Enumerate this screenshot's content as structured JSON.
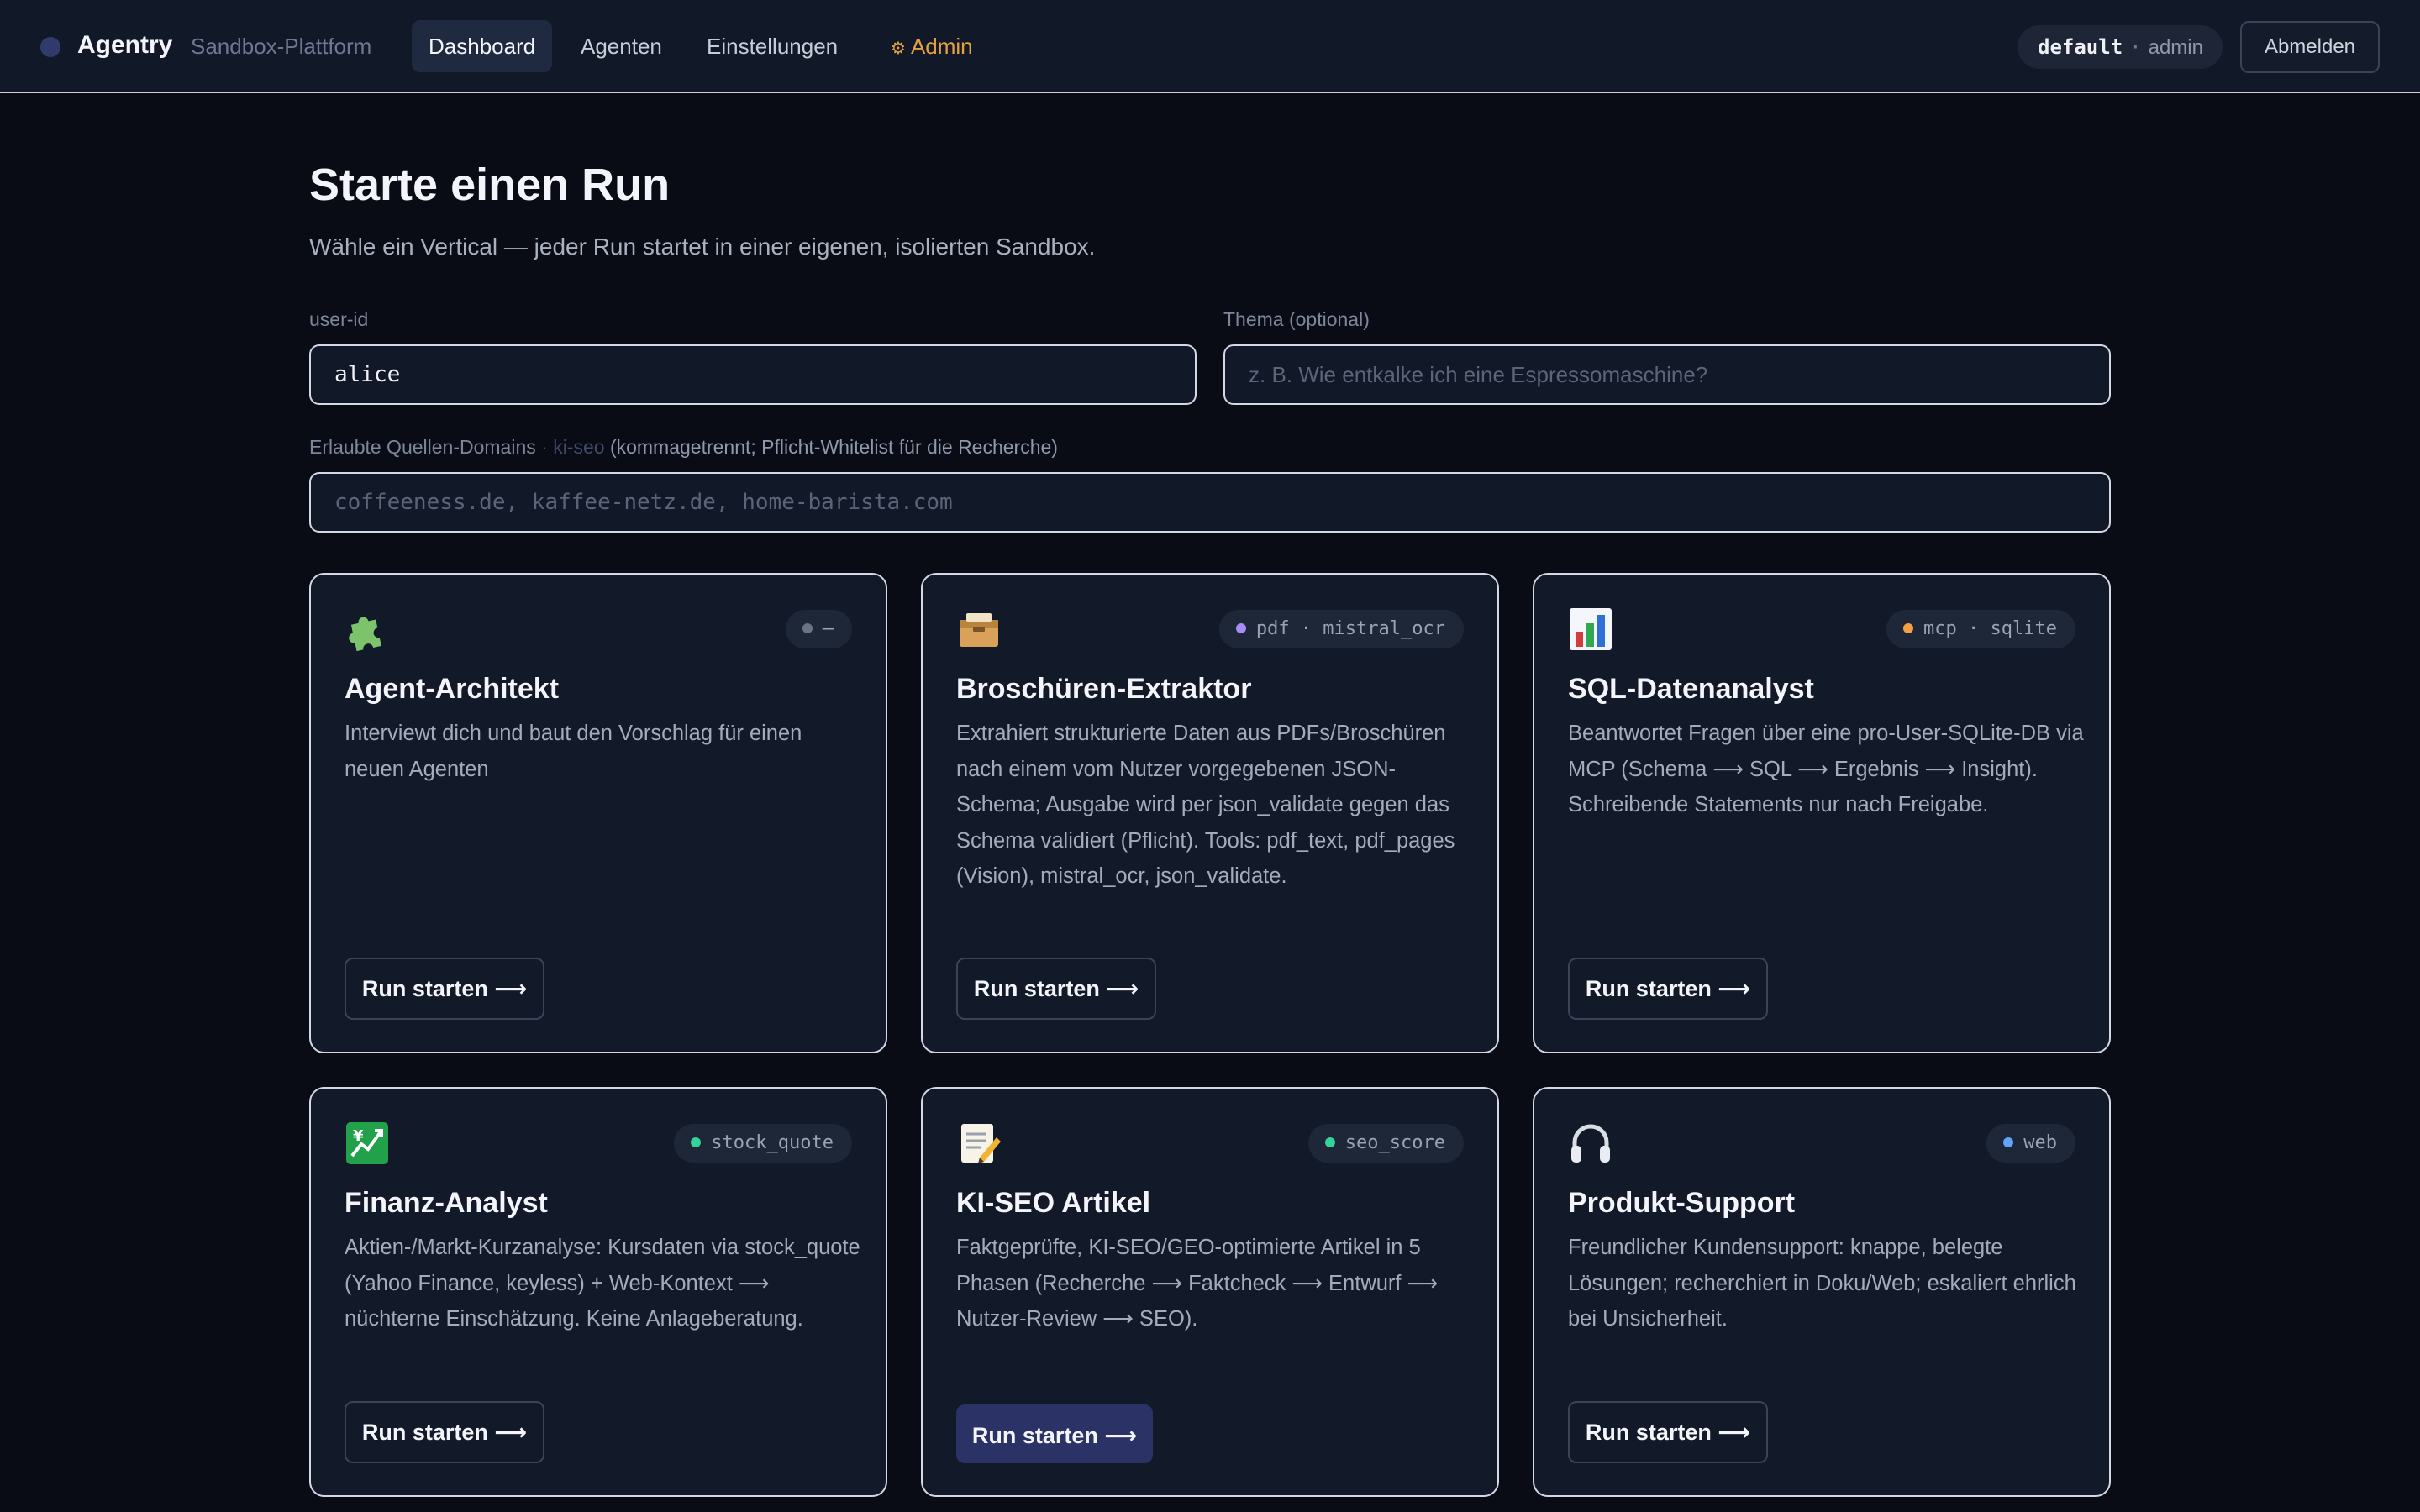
{
  "app": {
    "name": "Agentry",
    "subtitle": "Sandbox-Plattform"
  },
  "nav": {
    "items": [
      {
        "label": "Dashboard",
        "active": true
      },
      {
        "label": "Agenten",
        "active": false
      },
      {
        "label": "Einstellungen",
        "active": false
      },
      {
        "label": "Admin",
        "active": false,
        "icon": "gear-icon"
      }
    ],
    "admin_icon": "⚙"
  },
  "account": {
    "tenant": "default",
    "separator": "·",
    "role": "admin",
    "logout_label": "Abmelden"
  },
  "page": {
    "title": "Starte einen Run",
    "subtitle": "Wähle ein Vertical — jeder Run startet in einer eigenen, isolierten Sandbox."
  },
  "form": {
    "user_id": {
      "label": "user-id",
      "value": "alice"
    },
    "topic": {
      "label": "Thema (optional)",
      "placeholder": "z. B. Wie entkalke ich eine Espressomaschine?"
    },
    "domains": {
      "label": "Erlaubte Quellen-Domains",
      "tag": "· ki-seo",
      "hint": "(kommagetrennt; Pflicht-Whitelist für die Recherche)",
      "placeholder": "coffeeness.de, kaffee-netz.de, home-barista.com"
    }
  },
  "cards": [
    {
      "icon": "puzzle-icon",
      "badge": "–",
      "badge_color": "#6b7386",
      "title": "Agent-Architekt",
      "description": "Interviewt dich und baut den Vorschlag für einen neuen Agenten",
      "button": "Run starten ⟶"
    },
    {
      "icon": "card-box-icon",
      "badge": "pdf · mistral_ocr",
      "badge_color": "#a78bfa",
      "title": "Broschüren-Extraktor",
      "description": "Extrahiert strukturierte Daten aus PDFs/Broschüren nach einem vom Nutzer vorgegebenen JSON-Schema; Ausgabe wird per json_validate gegen das Schema validiert (Pflicht). Tools: pdf_text, pdf_pages (Vision), mistral_ocr, json_validate.",
      "button": "Run starten ⟶"
    },
    {
      "icon": "bar-chart-icon",
      "badge": "mcp · sqlite",
      "badge_color": "#f59e42",
      "title": "SQL-Datenanalyst",
      "description": "Beantwortet Fragen über eine pro-User-SQLite-DB via MCP (Schema ⟶ SQL ⟶ Ergebnis ⟶ Insight). Schreibende Statements nur nach Freigabe.",
      "button": "Run starten ⟶"
    },
    {
      "icon": "chart-yen-icon",
      "badge": "stock_quote",
      "badge_color": "#34d399",
      "title": "Finanz-Analyst",
      "description": "Aktien-/Markt-Kurzanalyse: Kursdaten via stock_quote (Yahoo Finance, keyless) + Web-Kontext ⟶ nüchterne Einschätzung. Keine Anlageberatung.",
      "button": "Run starten ⟶"
    },
    {
      "icon": "memo-icon",
      "badge": "seo_score",
      "badge_color": "#34d399",
      "title": "KI-SEO Artikel",
      "description": "Faktgeprüfte, KI-SEO/GEO-optimierte Artikel in 5 Phasen (Recherche ⟶ Faktcheck ⟶ Entwurf ⟶ Nutzer-Review ⟶ SEO).",
      "button": "Run starten ⟶"
    },
    {
      "icon": "headphones-icon",
      "badge": "web",
      "badge_color": "#60a5fa",
      "title": "Produkt-Support",
      "description": "Freundlicher Kundensupport: knappe, belegte Lösungen; recherchiert in Doku/Web; eskaliert ehrlich bei Unsicherheit.",
      "button": "Run starten ⟶"
    }
  ]
}
